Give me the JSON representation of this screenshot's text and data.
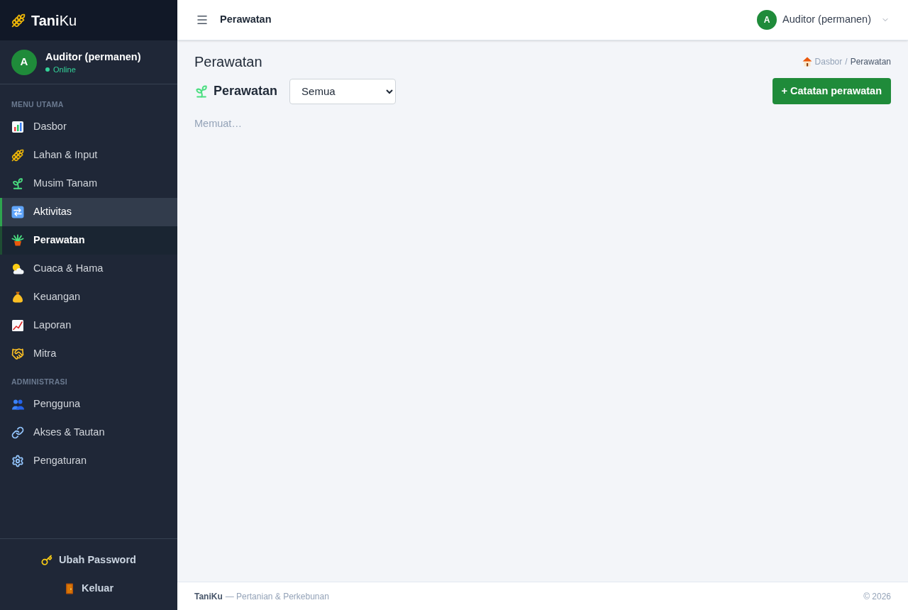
{
  "sidebar": {
    "brand": "**Tani**Ku",
    "user": {
      "avatar_initial": "A",
      "name": "Auditor (permanen)",
      "status": "Online"
    },
    "sections": [
      {
        "heading": "MENU UTAMA",
        "items": [
          {
            "label": "Dasbor",
            "selected": false,
            "hovered": false
          },
          {
            "label": "Lahan & Input",
            "selected": false,
            "hovered": false
          },
          {
            "label": "Musim Tanam",
            "selected": false,
            "hovered": false
          },
          {
            "label": "Aktivitas",
            "selected": false,
            "hovered": true
          },
          {
            "label": "Perawatan",
            "selected": true,
            "hovered": false
          },
          {
            "label": "Cuaca & Hama",
            "selected": false,
            "hovered": false
          },
          {
            "label": "Keuangan",
            "selected": false,
            "hovered": false
          },
          {
            "label": "Laporan",
            "selected": false,
            "hovered": false
          },
          {
            "label": "Mitra",
            "selected": false,
            "hovered": false
          }
        ]
      },
      {
        "heading": "ADMINISTRASI",
        "items": [
          {
            "label": "Pengguna",
            "selected": false,
            "hovered": false
          },
          {
            "label": "Akses & Tautan",
            "selected": false,
            "hovered": false
          },
          {
            "label": "Pengaturan",
            "selected": false,
            "hovered": false
          }
        ]
      }
    ],
    "footer_actions": [
      "Ubah Password",
      "Keluar"
    ]
  },
  "topbar": {
    "title": "Perawatan",
    "user": {
      "avatar_initial": "A",
      "name": "Auditor (permanen)"
    }
  },
  "page": {
    "title": "Perawatan",
    "breadcrumb": [
      {
        "label": "Dasbor",
        "current": false
      },
      {
        "label": "Perawatan",
        "current": true
      }
    ],
    "breadcrumb_separator": "/",
    "heading": "Perawatan",
    "filter": {
      "value": "Semua"
    },
    "add_button": "+ Catatan perawatan",
    "status_text": "Memuat…"
  },
  "footer": {
    "brand": "TaniKu",
    "tagline": "— Pertanian & Perkebunan",
    "copyright": "© 2026"
  }
}
